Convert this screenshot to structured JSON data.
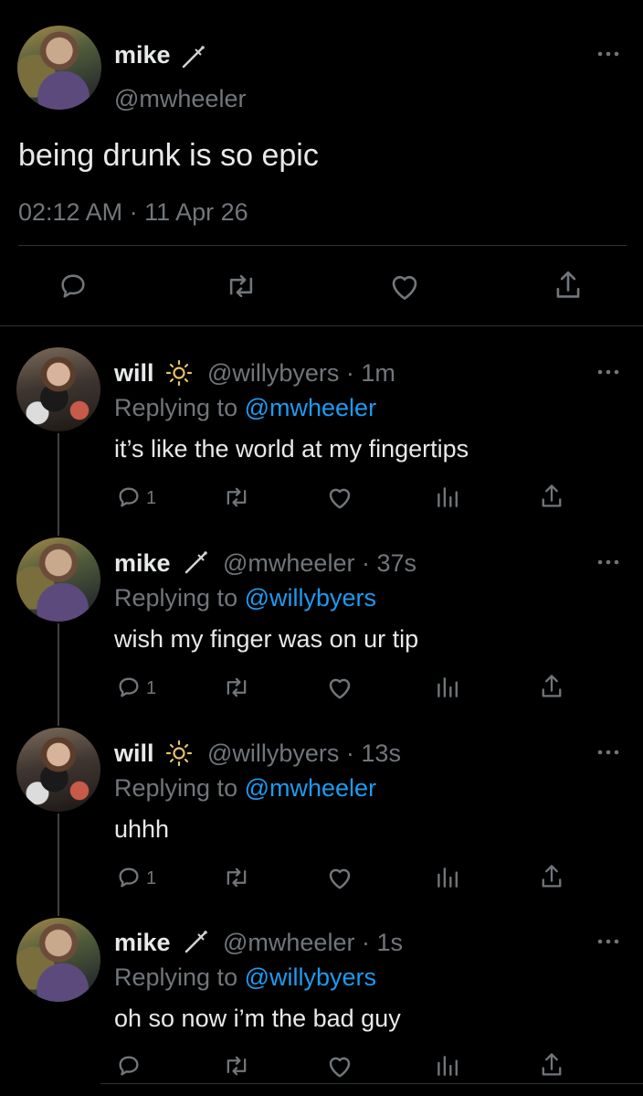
{
  "main_tweet": {
    "name": "mike",
    "name_emoji": "🗡",
    "handle": "@mwheeler",
    "text": "being drunk is so epic",
    "timestamp": "02:12 AM · 11 Apr 26"
  },
  "replies": [
    {
      "name": "will",
      "name_emoji": "🔆",
      "handle_time": "@willybyers · 1m",
      "replying_prefix": "Replying to",
      "replying_to": "@mwheeler",
      "text": "it’s like the world at my fingertips",
      "reply_count": "1"
    },
    {
      "name": "mike",
      "name_emoji": "🗡",
      "handle_time": "@mwheeler · 37s",
      "replying_prefix": "Replying to",
      "replying_to": "@willybyers",
      "text": "wish my finger was on ur tip",
      "reply_count": "1"
    },
    {
      "name": "will",
      "name_emoji": "🔆",
      "handle_time": "@willybyers · 13s",
      "replying_prefix": "Replying to",
      "replying_to": "@mwheeler",
      "text": "uhhh",
      "reply_count": "1"
    },
    {
      "name": "mike",
      "name_emoji": "🗡",
      "handle_time": "@mwheeler · 1s",
      "replying_prefix": "Replying to",
      "replying_to": "@willybyers",
      "text": "oh so now i’m the bad guy",
      "reply_count": ""
    }
  ],
  "icons": {
    "more": "more-horizontal-icon",
    "reply": "reply-bubble-icon",
    "retweet": "retweet-icon",
    "like": "heart-icon",
    "analytics": "analytics-bars-icon",
    "share": "share-icon"
  },
  "colors": {
    "background": "#000000",
    "text": "#e7e9ea",
    "muted": "#71767b",
    "link": "#1d9bf0",
    "divider": "#2f3336"
  }
}
